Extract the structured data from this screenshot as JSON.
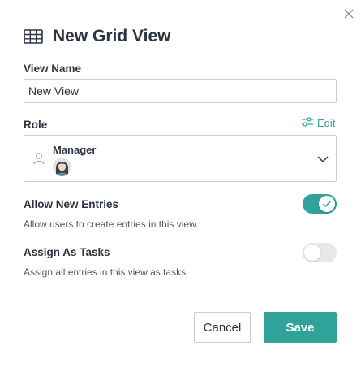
{
  "dialog": {
    "title": "New Grid View"
  },
  "view_name": {
    "label": "View Name",
    "value": "New View"
  },
  "role": {
    "label": "Role",
    "edit_label": "Edit",
    "selected": "Manager"
  },
  "allow_new_entries": {
    "label": "Allow New Entries",
    "description": "Allow users to create entries in this view.",
    "enabled": true
  },
  "assign_as_tasks": {
    "label": "Assign As Tasks",
    "description": "Assign all entries in this view as tasks.",
    "enabled": false
  },
  "footer": {
    "cancel_label": "Cancel",
    "save_label": "Save"
  },
  "colors": {
    "accent": "#2fa39a",
    "text": "#2b3440",
    "border": "#c9ccd0",
    "toggle_off": "#e6e8ea"
  }
}
